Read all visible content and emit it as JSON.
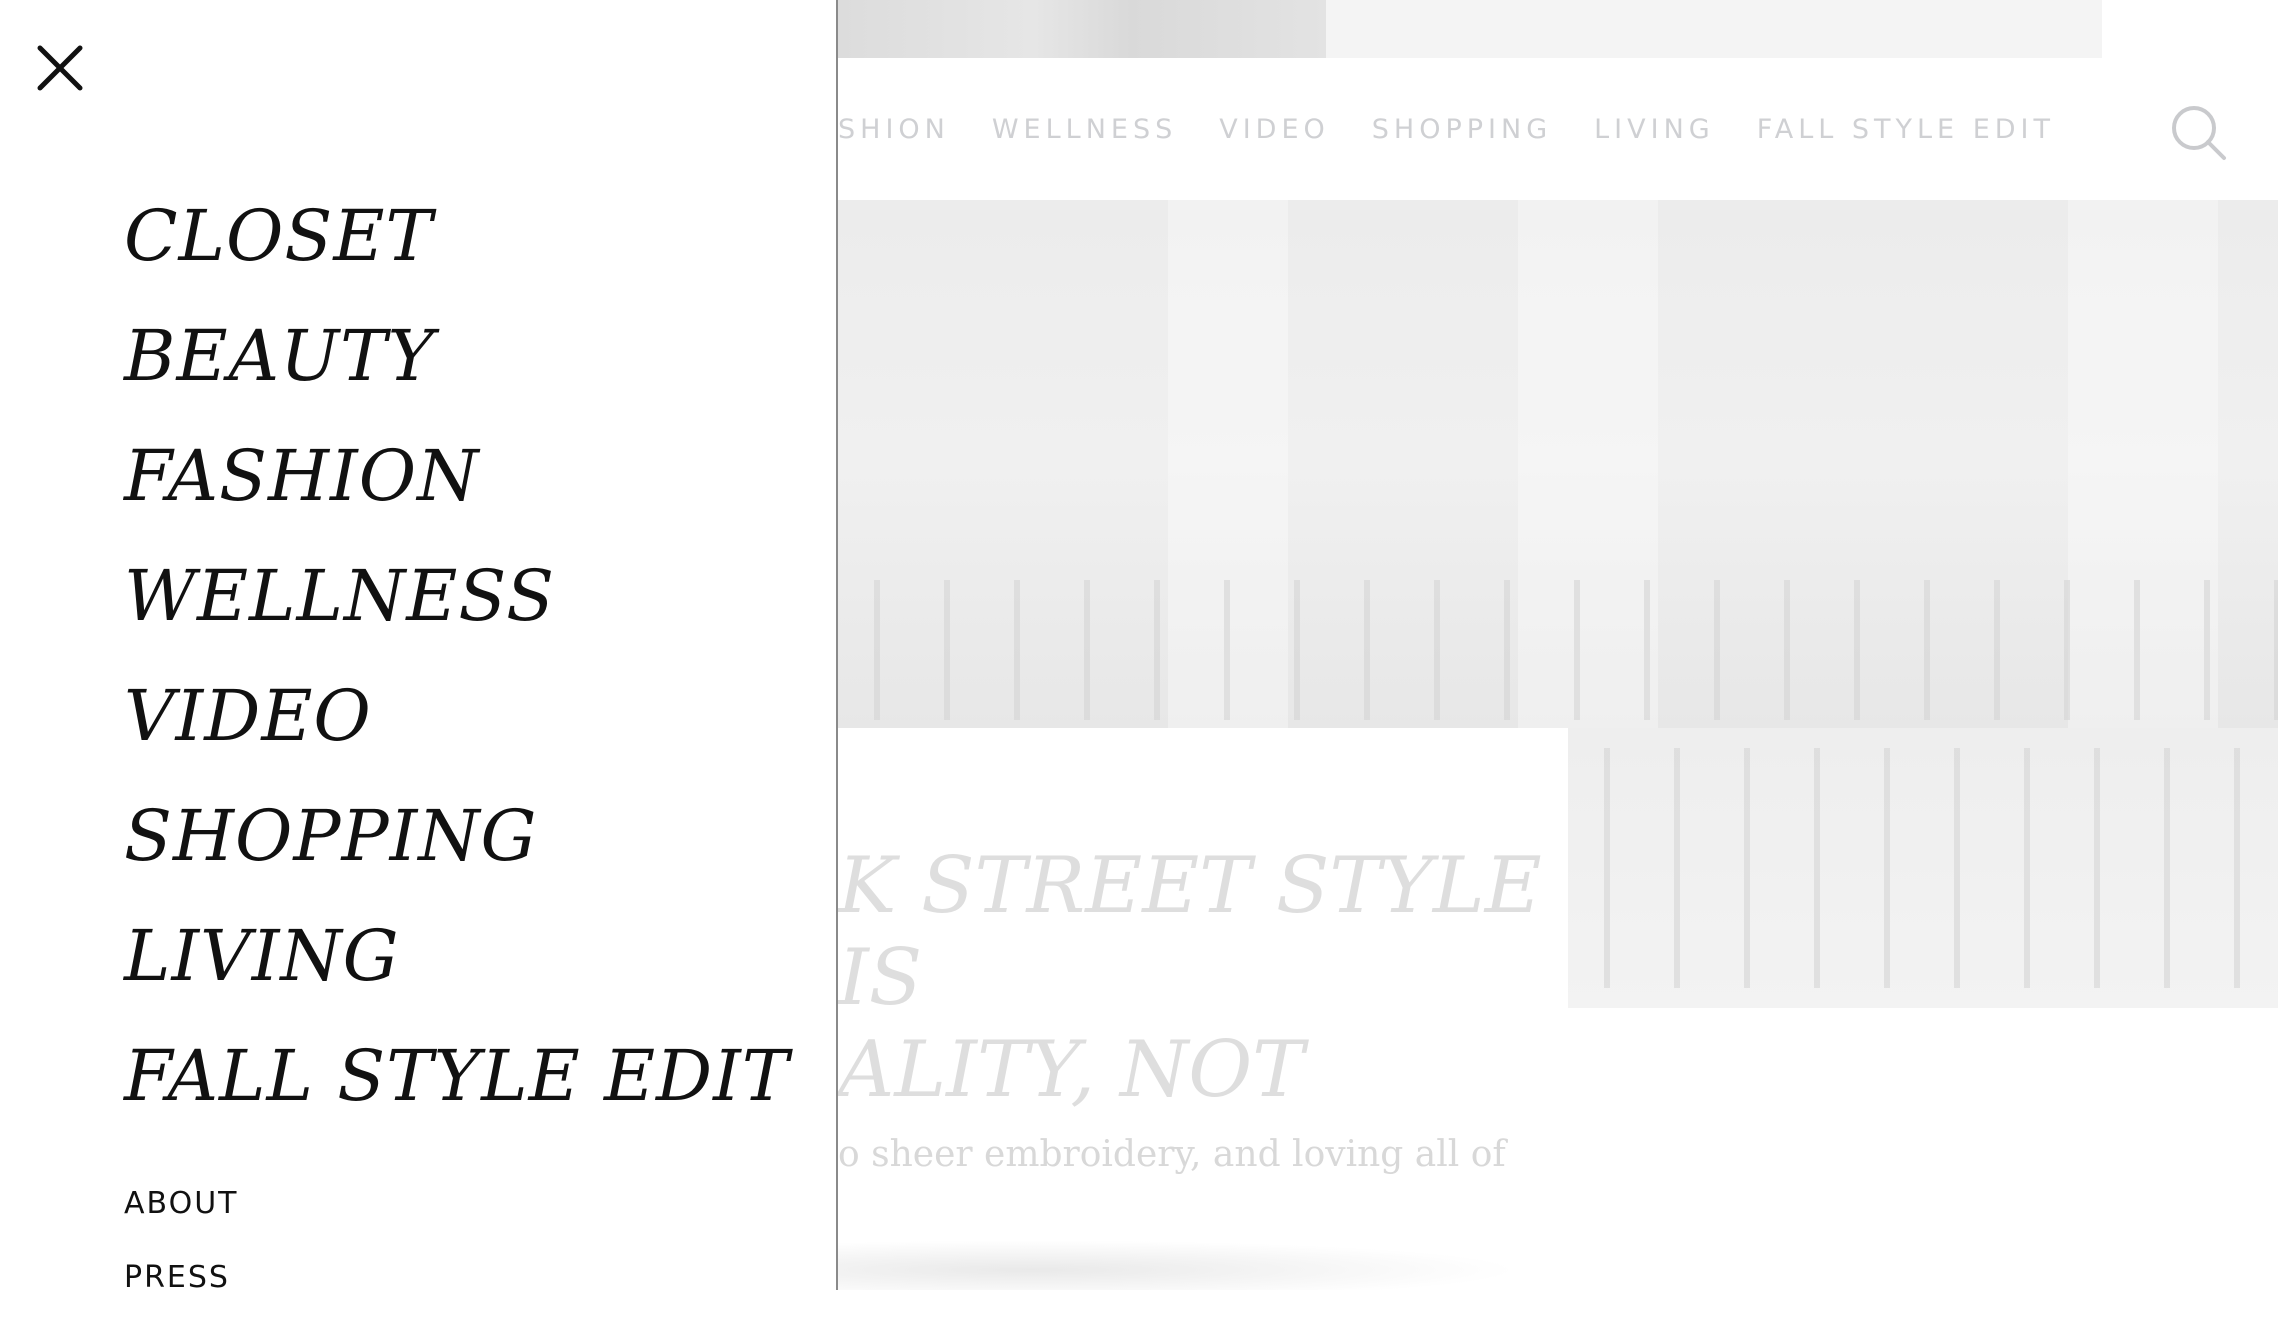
{
  "background_page": {
    "top_nav": [
      "SHION",
      "WELLNESS",
      "VIDEO",
      "SHOPPING",
      "LIVING",
      "FALL STYLE EDIT"
    ],
    "article_title": "K STREET STYLE IS\nALITY, NOT",
    "article_excerpt": "o sheer embroidery, and loving all of"
  },
  "menu": {
    "close_icon": "close-icon",
    "main_items": [
      "CLOSET",
      "BEAUTY",
      "FASHION",
      "WELLNESS",
      "VIDEO",
      "SHOPPING",
      "LIVING",
      "FALL STYLE EDIT"
    ],
    "secondary_items": [
      "ABOUT",
      "PRESS"
    ]
  },
  "colors": {
    "menu_text": "#111111",
    "dimmed_nav": "#cfd0d3",
    "panel_border": "#8a8a8a"
  },
  "icons": {
    "search": "search-icon",
    "close": "close-icon"
  }
}
